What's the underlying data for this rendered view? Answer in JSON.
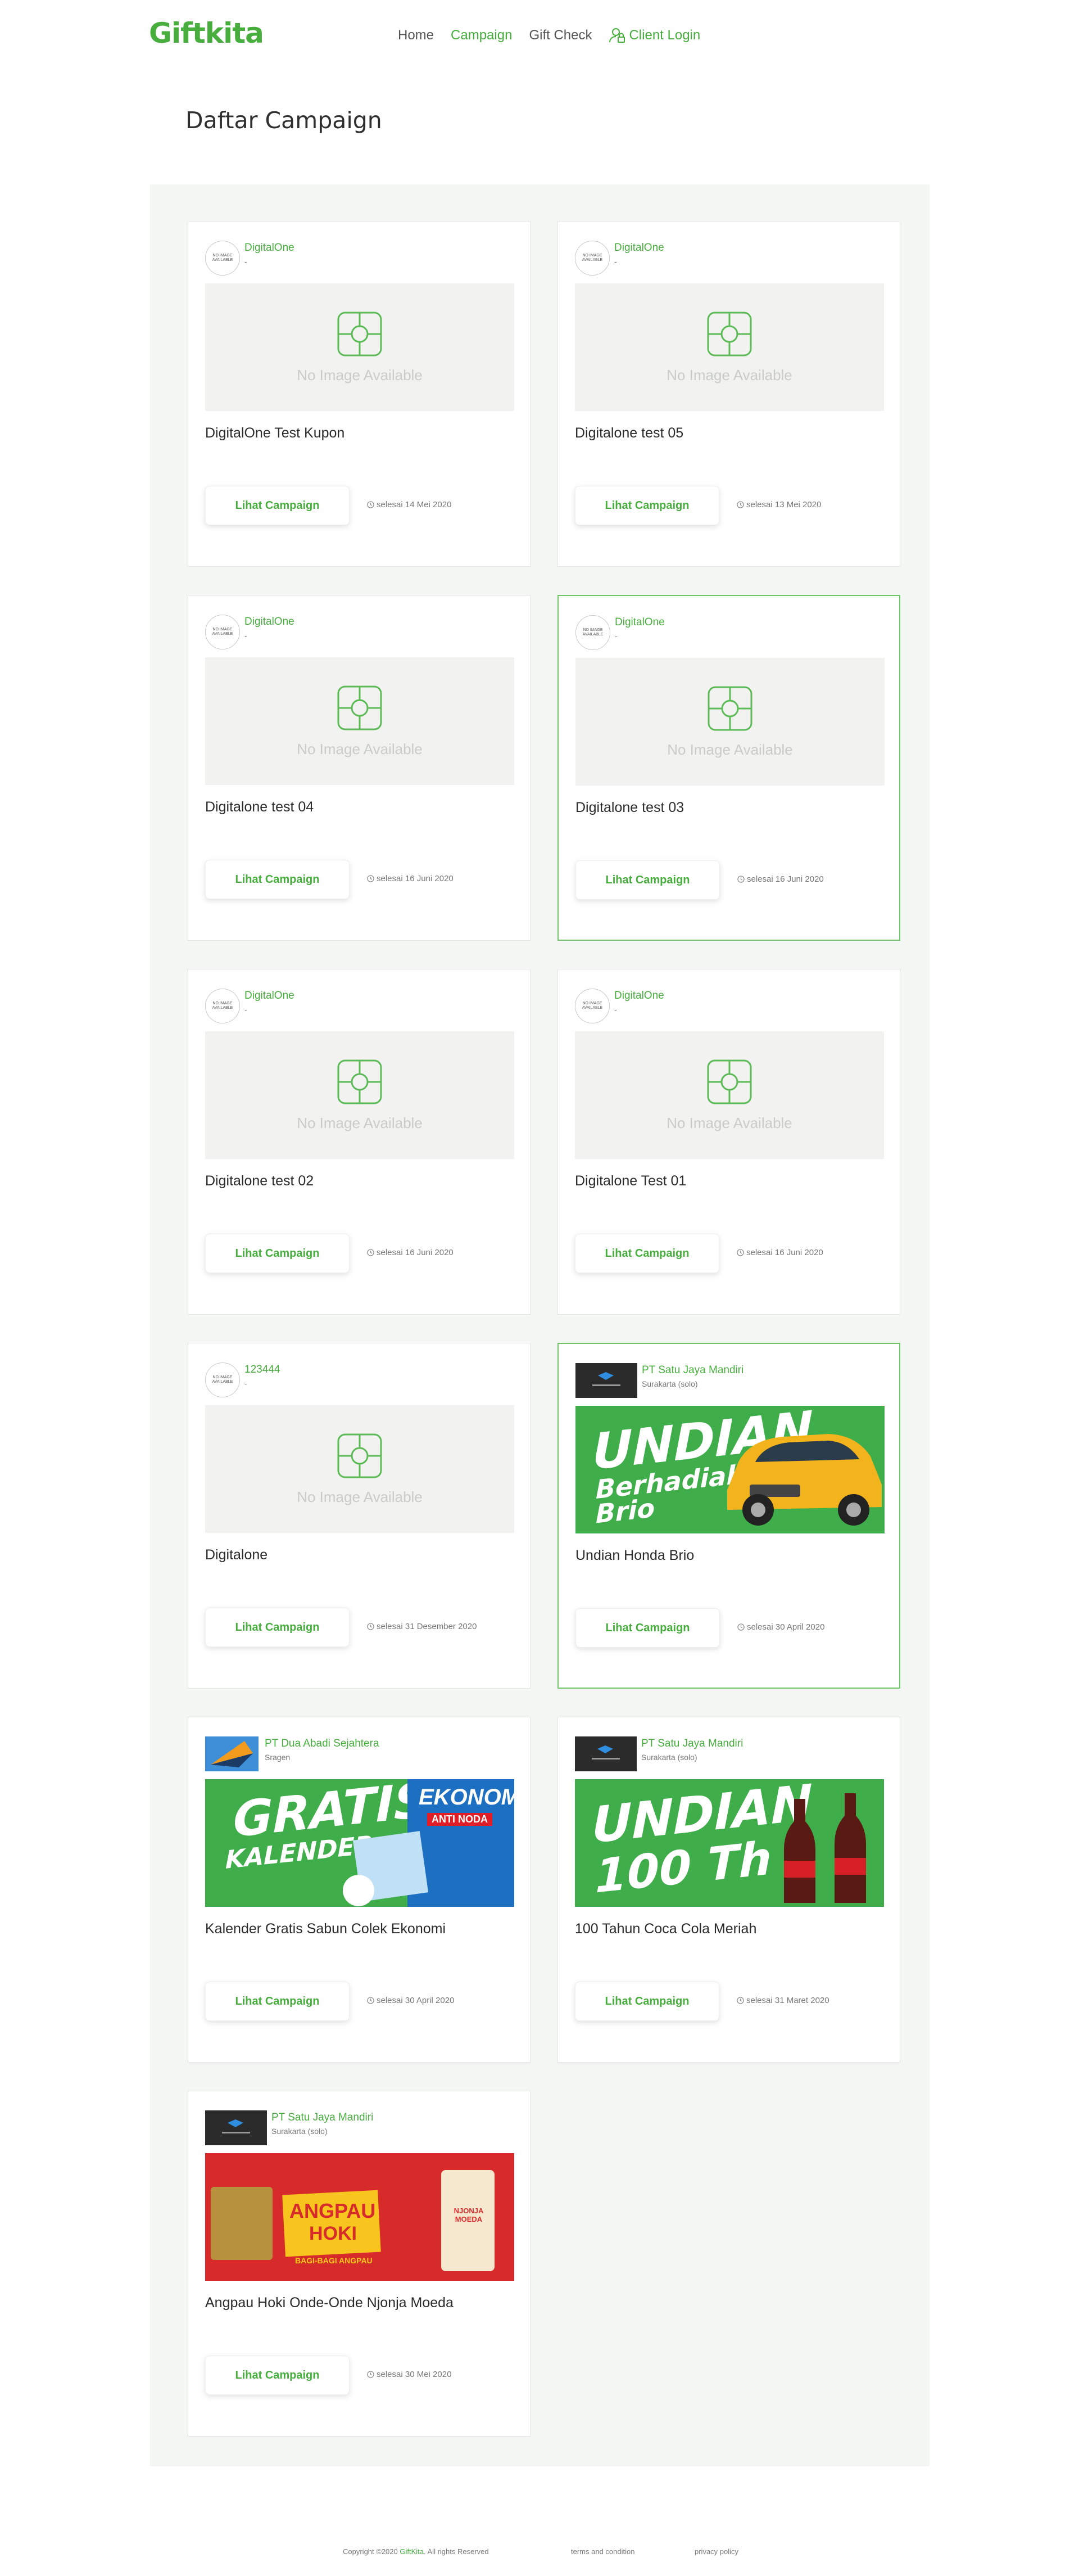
{
  "header": {
    "brand": "Giftkita",
    "nav": [
      "Home",
      "Campaign",
      "Gift Check"
    ],
    "login": "Client Login"
  },
  "page_title": "Daftar Campaign",
  "no_image_text": "No Image Available",
  "placeholder_logo_text": "NO IMAGE AVAILABLE",
  "button_label": "Lihat Campaign",
  "campaigns": [
    {
      "org": "DigitalOne",
      "loc": "-",
      "title": "DigitalOne Test Kupon",
      "deadline": "selesai 14 Mei 2020"
    },
    {
      "org": "DigitalOne",
      "loc": "-",
      "title": "Digitalone test 05",
      "deadline": "selesai 13 Mei 2020"
    },
    {
      "org": "DigitalOne",
      "loc": "-",
      "title": "Digitalone test 04",
      "deadline": "selesai 16 Juni 2020"
    },
    {
      "org": "DigitalOne",
      "loc": "-",
      "title": "Digitalone test 03",
      "deadline": "selesai 16 Juni 2020"
    },
    {
      "org": "DigitalOne",
      "loc": "-",
      "title": "Digitalone test 02",
      "deadline": "selesai 16 Juni 2020"
    },
    {
      "org": "DigitalOne",
      "loc": "-",
      "title": "Digitalone Test 01",
      "deadline": "selesai 16 Juni 2020"
    },
    {
      "org": "123444",
      "loc": "-",
      "title": "Digitalone",
      "deadline": "selesai 31 Desember 2020"
    },
    {
      "org": "PT Satu Jaya Mandiri",
      "loc": "Surakarta (solo)",
      "title": "Undian Honda Brio",
      "deadline": "selesai 30 April 2020",
      "banner": {
        "line1": "UNDIAN",
        "line2": "Berhadiah",
        "line3": "Brio"
      }
    },
    {
      "org": "PT Dua Abadi Sejahtera",
      "loc": "Sragen",
      "title": "Kalender Gratis Sabun Colek Ekonomi",
      "deadline": "selesai 30 April 2020",
      "banner": {
        "line1": "GRATIS",
        "line2": "KALENDER",
        "line3": "EKONOMI",
        "line4": "ANTI NODA"
      }
    },
    {
      "org": "PT Satu Jaya Mandiri",
      "loc": "Surakarta (solo)",
      "title": "100 Tahun Coca Cola Meriah",
      "deadline": "selesai 31 Maret 2020",
      "banner": {
        "line1": "UNDIAN",
        "line2": "100 Th"
      }
    },
    {
      "org": "PT Satu Jaya Mandiri",
      "loc": "Surakarta (solo)",
      "title": "Angpau Hoki Onde-Onde Njonja Moeda",
      "deadline": "selesai 30 Mei 2020",
      "banner": {
        "line1": "ANGPAU",
        "line2": "HOKI",
        "line3": "BAGI-BAGI ANGPAU",
        "line4": "NJONJA MOEDA"
      }
    }
  ],
  "footer": {
    "copyright_pre": "Copyright ©2020",
    "copyright_brand": "GiftKita",
    "copyright_post": ". All rights Reserved",
    "terms": "terms and condition",
    "privacy": "privacy policy"
  },
  "colors": {
    "accent": "#47ad3d",
    "panel": "#f4f6f3",
    "highlight_border": "#6fc666"
  }
}
